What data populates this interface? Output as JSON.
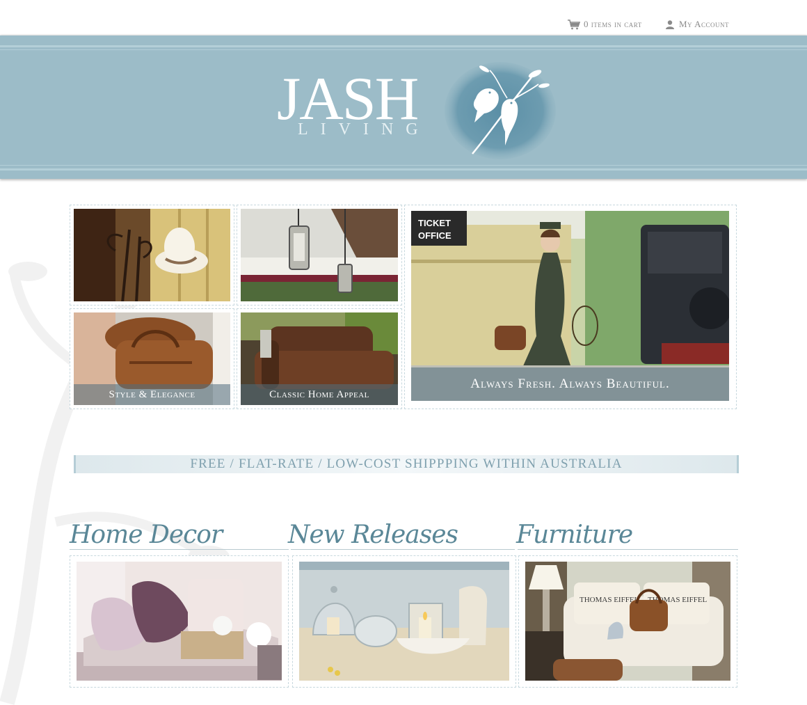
{
  "topbar": {
    "cart_label": "0 items in cart",
    "account_label": "My Account",
    "cart_icon": "cart-icon",
    "account_icon": "user-icon"
  },
  "logo": {
    "title": "JASH",
    "subtitle": "LIVING",
    "icon": "birds-on-branch-icon"
  },
  "features": {
    "tile1_caption": "Style & Elegance",
    "tile2_caption": "Classic Home Appeal",
    "hero_caption": "Always Fresh. Always Beautiful.",
    "hero_sign": "TICKET OFFICE",
    "hero_sign_line1": "TICKET",
    "hero_sign_line2": "OFFICE"
  },
  "shipping": {
    "text": "FREE / FLAT-RATE / LOW-COST SHIPPPING WITHIN AUSTRALIA"
  },
  "categories": [
    {
      "title": "Home Decor"
    },
    {
      "title": "New Releases"
    },
    {
      "title": "Furniture",
      "sofa_text": "THOMAS EIFFEL"
    }
  ],
  "colors": {
    "header": "#9cbcc8",
    "accent": "#5a8797",
    "text_muted": "#8a8a8a"
  }
}
